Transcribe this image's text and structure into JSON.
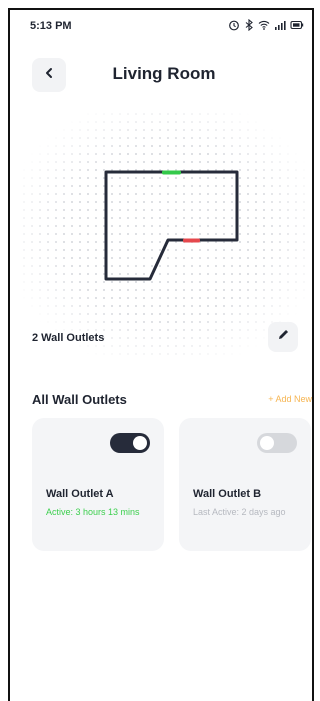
{
  "status_bar": {
    "time": "5:13 PM",
    "icons": [
      "alarm-icon",
      "bluetooth-icon",
      "wifi-icon",
      "signal-icon",
      "battery-icon"
    ]
  },
  "header": {
    "title": "Living Room",
    "back_icon": "chevron-left-icon"
  },
  "room_map": {
    "outlets": [
      {
        "color": "#34c94a"
      },
      {
        "color": "#e5484d"
      }
    ],
    "wall_color": "#262b3a"
  },
  "map_footer": {
    "outlet_count_label": "2 Wall Outlets",
    "edit_icon": "pencil-icon"
  },
  "outlets_section": {
    "title": "All Wall Outlets",
    "add_new_label": "+ Add New",
    "accent_color": "#f6b552"
  },
  "outlets": [
    {
      "name": "Wall Outlet A",
      "status": "Active: 3 hours 13 mins",
      "on": true
    },
    {
      "name": "Wall Outlet B",
      "status": "Last Active: 2 days ago",
      "on": false
    }
  ]
}
